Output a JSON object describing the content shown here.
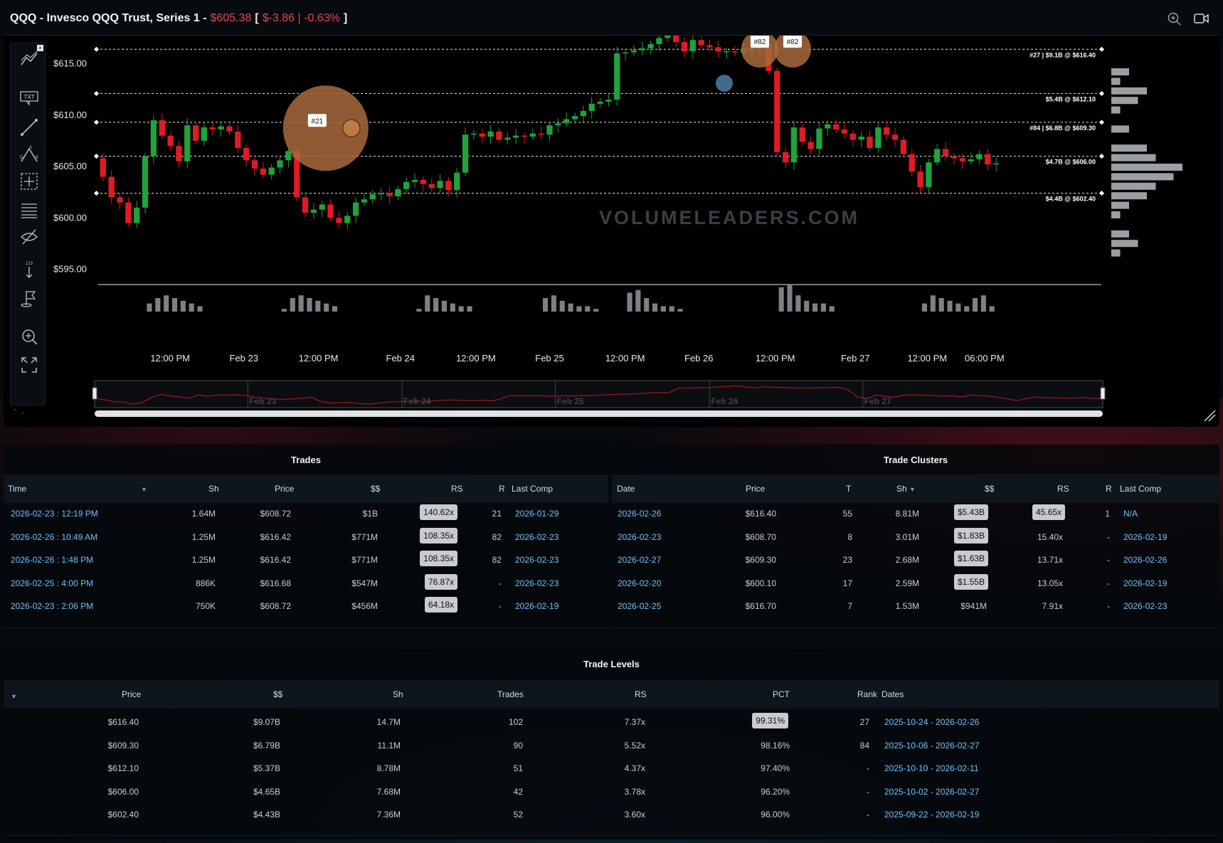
{
  "header": {
    "title": "QQQ - Invesco QQQ Trust, Series 1 -",
    "price": "$605.38",
    "change": "$-3.86 | -0.63%",
    "open_bracket": "[",
    "close_bracket": "]",
    "icons": [
      "zoom-in-icon",
      "video-icon"
    ]
  },
  "toolbar": {
    "tools": [
      "trend-lines-icon",
      "text-icon",
      "line-icon",
      "triangle-pattern-icon",
      "crosshair-icon",
      "fib-levels-icon",
      "hide-icon",
      "measure-icon",
      "flag-icon",
      "zoom-icon",
      "fullscreen-icon"
    ],
    "text_tool_label": "TXT",
    "measure_label": "123"
  },
  "chart_data": {
    "type": "candlestick",
    "title": "",
    "watermark": "VOLUMELEADERS.COM",
    "y_ticks": [
      "$615.00",
      "$610.00",
      "$605.00",
      "$600.00",
      "$595.00"
    ],
    "y_tick_values": [
      615,
      610,
      605,
      600,
      595
    ],
    "ylim": [
      594,
      620.5
    ],
    "x_ticks": [
      "12:00 PM",
      "Feb 23",
      "12:00 PM",
      "Feb 24",
      "12:00 PM",
      "Feb 25",
      "12:00 PM",
      "Feb 26",
      "12:00 PM",
      "Feb 27",
      "12:00 PM",
      "06:00 PM"
    ],
    "x_tick_positions": [
      0.083,
      0.164,
      0.246,
      0.336,
      0.419,
      0.5,
      0.583,
      0.664,
      0.748,
      0.836,
      0.915,
      0.978
    ],
    "levels": [
      {
        "label": "#27 | $9.1B @ $616.40",
        "price": 616.4
      },
      {
        "label": "$5.4B @ $612.10",
        "price": 612.1
      },
      {
        "label": "#84 | $6.8B @ $609.30",
        "price": 609.3
      },
      {
        "label": "$4.7B @ $606.00",
        "price": 606.0
      },
      {
        "label": "$4.4B @ $602.40",
        "price": 602.4
      }
    ],
    "trade_bubbles": [
      {
        "label": "#21",
        "price": 608.72,
        "x_frac": 0.254,
        "size": 1.64
      },
      {
        "label": "#82",
        "price": 616.42,
        "x_frac": 0.731,
        "size": 1.25
      },
      {
        "label": "#82",
        "price": 616.42,
        "x_frac": 0.767,
        "size": 1.25
      }
    ],
    "price_path": [
      605.8,
      604,
      602,
      601.5,
      599.5,
      601,
      606,
      609.5,
      608,
      607,
      605.5,
      609,
      607.5,
      608.8,
      608.6,
      608.9,
      608.4,
      606.8,
      605.6,
      604.8,
      604.2,
      604.9,
      605.6,
      606.5,
      602,
      600.5,
      600.8,
      601.3,
      600,
      599.5,
      600.2,
      601.5,
      601.8,
      602.3,
      602.4,
      602.1,
      602.8,
      603.5,
      603.7,
      603.3,
      602.9,
      603.6,
      602.7,
      604.4,
      608.1,
      608.2,
      607.9,
      608.4,
      607.6,
      607.8,
      608,
      607.9,
      608.2,
      608.1,
      609,
      609.2,
      609.6,
      609.9,
      610.4,
      611.1,
      611.3,
      611.5,
      616,
      616.1,
      616.3,
      616.5,
      616.9,
      617.5,
      618.2,
      617.1,
      616.2,
      617.3,
      616.8,
      616.6,
      616.2,
      616.2,
      616.1,
      616.3,
      616.5,
      616.8,
      614.3,
      606.4,
      605.4,
      608.8,
      607.4,
      606.7,
      608.7,
      609.1,
      608.6,
      608.2,
      607.6,
      607.9,
      606.8,
      608.8,
      608.1,
      607.6,
      606.2,
      604.5,
      603,
      605.4,
      606.7,
      606,
      605.8,
      605.5,
      605.7,
      606.2,
      605.2,
      605.3
    ],
    "volume_bars": [
      0,
      0,
      0,
      0,
      0,
      0,
      3,
      5,
      6,
      5,
      4,
      3,
      2,
      0,
      0,
      0,
      0,
      0,
      0,
      0,
      0,
      0,
      1,
      5,
      6,
      5,
      4,
      3,
      2,
      0,
      0,
      0,
      0,
      0,
      0,
      0,
      0,
      0,
      1,
      6,
      5,
      4,
      3,
      2,
      2,
      0,
      0,
      0,
      0,
      0,
      0,
      0,
      0,
      5,
      6,
      4,
      3,
      2,
      2,
      1,
      0,
      0,
      0,
      7,
      8,
      5,
      3,
      2,
      2,
      1,
      0,
      0,
      0,
      0,
      0,
      0,
      0,
      0,
      0,
      0,
      0,
      9,
      10,
      6,
      4,
      3,
      3,
      2,
      0,
      0,
      0,
      0,
      0,
      0,
      0,
      0,
      0,
      0,
      3,
      6,
      5,
      4,
      3,
      2,
      5,
      6,
      2,
      0
    ],
    "volume_profile": [
      2,
      1,
      4,
      3,
      1,
      0,
      2,
      0,
      4,
      5,
      8,
      7,
      5,
      4,
      2,
      1,
      0,
      2,
      3,
      1,
      0
    ],
    "navigator_labels": [
      "Feb 23",
      "Feb 24",
      "Feb 25",
      "Feb 26",
      "Feb 27"
    ]
  },
  "trades": {
    "title": "Trades",
    "columns": [
      "Time",
      "Sh",
      "Price",
      "$$",
      "RS",
      "R",
      "Last Comp"
    ],
    "rows": [
      {
        "time": "2026-02-23 : 12:19 PM",
        "sh": "1.64M",
        "price": "$608.72",
        "dollars": "$1B",
        "rs": "140.62x",
        "r": "21",
        "last_comp": "2026-01-29"
      },
      {
        "time": "2026-02-26 : 10:49 AM",
        "sh": "1.25M",
        "price": "$616.42",
        "dollars": "$771M",
        "rs": "108.35x",
        "r": "82",
        "last_comp": "2026-02-23"
      },
      {
        "time": "2026-02-26 : 1:48 PM",
        "sh": "1.25M",
        "price": "$616.42",
        "dollars": "$771M",
        "rs": "108.35x",
        "r": "82",
        "last_comp": "2026-02-23"
      },
      {
        "time": "2026-02-25 : 4:00 PM",
        "sh": "886K",
        "price": "$616.68",
        "dollars": "$547M",
        "rs": "76.87x",
        "r": "-",
        "last_comp": "2026-02-23"
      },
      {
        "time": "2026-02-23 : 2:06 PM",
        "sh": "750K",
        "price": "$608.72",
        "dollars": "$456M",
        "rs": "64.18x",
        "r": "-",
        "last_comp": "2026-02-19"
      }
    ]
  },
  "clusters": {
    "title": "Trade Clusters",
    "columns": [
      "Date",
      "Price",
      "T",
      "Sh",
      "$$",
      "RS",
      "R",
      "Last Comp"
    ],
    "rows": [
      {
        "date": "2026-02-26",
        "price": "$616.40",
        "t": "55",
        "sh": "8.81M",
        "dollars": "$5.43B",
        "rs": "45.65x",
        "r": "1",
        "last_comp": "N/A",
        "dollars_pill": true,
        "rs_pill": true
      },
      {
        "date": "2026-02-23",
        "price": "$608.70",
        "t": "8",
        "sh": "3.01M",
        "dollars": "$1.83B",
        "rs": "15.40x",
        "r": "-",
        "last_comp": "2026-02-19",
        "dollars_pill": true,
        "rs_pill": false
      },
      {
        "date": "2026-02-27",
        "price": "$609.30",
        "t": "23",
        "sh": "2.68M",
        "dollars": "$1.63B",
        "rs": "13.71x",
        "r": "-",
        "last_comp": "2026-02-26",
        "dollars_pill": true,
        "rs_pill": false
      },
      {
        "date": "2026-02-20",
        "price": "$600.10",
        "t": "17",
        "sh": "2.59M",
        "dollars": "$1.55B",
        "rs": "13.05x",
        "r": "-",
        "last_comp": "2026-02-19",
        "dollars_pill": true,
        "rs_pill": false
      },
      {
        "date": "2026-02-25",
        "price": "$616.70",
        "t": "7",
        "sh": "1.53M",
        "dollars": "$941M",
        "rs": "7.91x",
        "r": "-",
        "last_comp": "2026-02-23",
        "dollars_pill": false,
        "rs_pill": false
      }
    ]
  },
  "levels": {
    "title": "Trade Levels",
    "columns": [
      "Price",
      "$$",
      "Sh",
      "Trades",
      "RS",
      "PCT",
      "Rank",
      "Dates"
    ],
    "rows": [
      {
        "price": "$616.40",
        "dollars": "$9.07B",
        "sh": "14.7M",
        "trades": "102",
        "rs": "7.37x",
        "pct": "99.31%",
        "rank": "27",
        "dates": "2025-10-24 - 2026-02-26",
        "pct_pill": true
      },
      {
        "price": "$609.30",
        "dollars": "$6.79B",
        "sh": "11.1M",
        "trades": "90",
        "rs": "5.52x",
        "pct": "98.16%",
        "rank": "84",
        "dates": "2025-10-06 - 2026-02-27",
        "pct_pill": false
      },
      {
        "price": "$612.10",
        "dollars": "$5.37B",
        "sh": "8.78M",
        "trades": "51",
        "rs": "4.37x",
        "pct": "97.40%",
        "rank": "-",
        "dates": "2025-10-10 - 2026-02-11",
        "pct_pill": false
      },
      {
        "price": "$606.00",
        "dollars": "$4.65B",
        "sh": "7.68M",
        "trades": "42",
        "rs": "3.78x",
        "pct": "96.20%",
        "rank": "-",
        "dates": "2025-10-02 - 2026-02-27",
        "pct_pill": false
      },
      {
        "price": "$602.40",
        "dollars": "$4.43B",
        "sh": "7.36M",
        "trades": "52",
        "rs": "3.60x",
        "pct": "96.00%",
        "rank": "-",
        "dates": "2025-09-22 - 2026-02-19",
        "pct_pill": false
      }
    ]
  },
  "colors": {
    "up": "#1fa33a",
    "down": "#e01b24",
    "bubble": "#a86a3c",
    "link": "#6cc2ff",
    "price_down": "#e8424a"
  }
}
